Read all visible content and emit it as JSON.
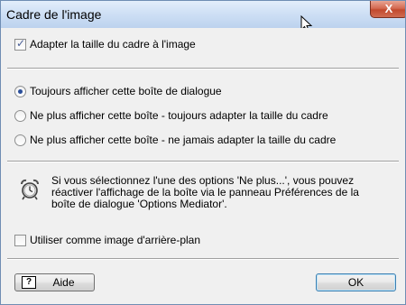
{
  "window": {
    "title": "Cadre de l'image",
    "close_label": "X"
  },
  "options": {
    "fit_frame_label": "Adapter la taille du cadre à l'image",
    "fit_frame_checked": true,
    "radios": [
      {
        "label": "Toujours afficher cette boîte de dialogue",
        "selected": true
      },
      {
        "label": "Ne plus afficher cette boîte - toujours adapter la taille du cadre",
        "selected": false
      },
      {
        "label": "Ne plus afficher cette boîte - ne jamais adapter la taille du cadre",
        "selected": false
      }
    ],
    "info_lines": [
      "Si vous sélectionnez l'une des options 'Ne plus...', vous pouvez",
      "réactiver l'affichage de la boîte via le panneau Préférences de la",
      "boîte de dialogue 'Options Mediator'."
    ],
    "background_label": "Utiliser comme image d'arrière-plan",
    "background_checked": false
  },
  "buttons": {
    "help_icon_glyph": "?",
    "help_label": "Aide",
    "ok_label": "OK"
  },
  "icons": {
    "help": "help-icon",
    "alarm": "alarm-clock-icon",
    "cursor": "mouse-cursor-icon"
  }
}
